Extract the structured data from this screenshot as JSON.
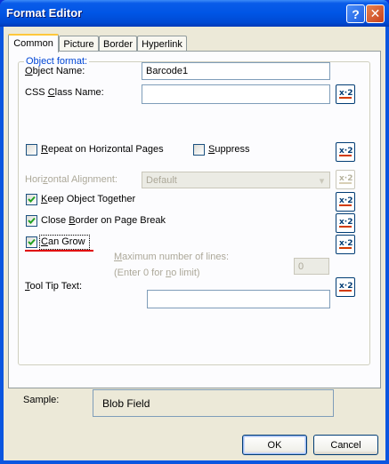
{
  "window": {
    "title": "Format Editor"
  },
  "tabs": [
    "Common",
    "Picture",
    "Border",
    "Hyperlink"
  ],
  "group": {
    "legend": "Object format:"
  },
  "object_name": {
    "label": "Object Name:",
    "value": "Barcode1"
  },
  "css_class": {
    "label": "CSS Class Name:",
    "value": ""
  },
  "repeat": {
    "label": "Repeat on Horizontal Pages",
    "checked": false
  },
  "suppress": {
    "label": "Suppress",
    "checked": false
  },
  "halign": {
    "label": "Horizontal Alignment:",
    "value": "Default"
  },
  "keep_together": {
    "label": "Keep Object Together",
    "checked": true
  },
  "close_border": {
    "label": "Close Border on Page Break",
    "checked": true
  },
  "can_grow": {
    "label": "Can Grow",
    "checked": true
  },
  "max_lines": {
    "label": "Maximum number of lines:",
    "hint": "(Enter 0 for no limit)",
    "value": "0"
  },
  "tooltip": {
    "label": "Tool Tip Text:",
    "value": ""
  },
  "sample": {
    "label": "Sample:",
    "value": "Blob Field"
  },
  "buttons": {
    "ok": "OK",
    "cancel": "Cancel"
  },
  "icons": {
    "formula": "formula-xy2-icon",
    "help": "help-icon",
    "close": "close-icon",
    "check": "check-icon"
  },
  "colors": {
    "titlebar": "#0055e5",
    "accent_underline": "#e00000",
    "legend_text": "#0046d5"
  }
}
